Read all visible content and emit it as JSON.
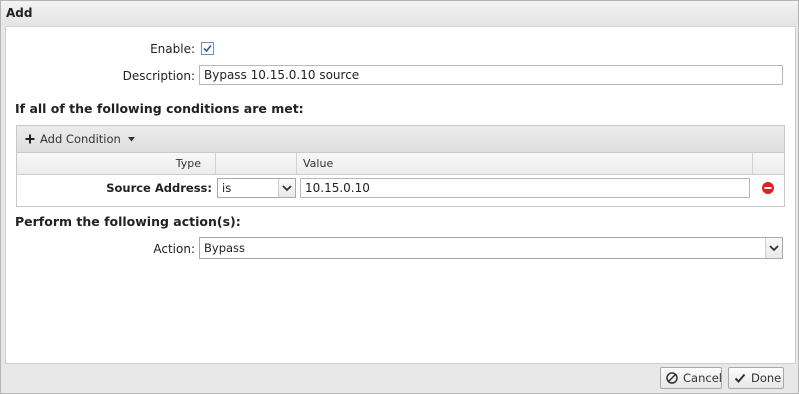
{
  "dialog": {
    "title": "Add"
  },
  "form": {
    "enable_label": "Enable:",
    "enable_checked": true,
    "description_label": "Description:",
    "description_value": "Bypass 10.15.0.10 source"
  },
  "conditions": {
    "heading": "If all of the following conditions are met:",
    "add_condition_label": "Add Condition",
    "columns": {
      "type": "Type",
      "operator": "",
      "value": "Value"
    },
    "rows": [
      {
        "type": "Source Address:",
        "operator": "is",
        "value": "10.15.0.10"
      }
    ]
  },
  "actions": {
    "heading": "Perform the following action(s):",
    "action_label": "Action:",
    "action_value": "Bypass"
  },
  "footer": {
    "cancel_label": "Cancel",
    "done_label": "Done"
  },
  "colors": {
    "remove_icon": "#e02020",
    "checkbox_check": "#3a5a8c"
  }
}
